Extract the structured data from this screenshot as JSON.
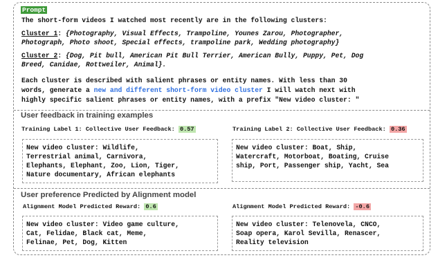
{
  "prompt": {
    "tag": "Prompt",
    "intro": "The short-form videos I watched most recently are in the following clusters:",
    "cluster1_label": "Cluster 1",
    "cluster1_line1": "{Photography, Visual Effects, Trampoline, Younes Zarou, Photographer,",
    "cluster1_line2": "Photograph, Photo shoot, Special effects, trampoline park, Wedding photography}",
    "cluster2_label": "Cluster 2",
    "cluster2_line1": "{Dog, Pit bull, American Pit Bull Terrier, American Bully, Puppy, Pet, Dog",
    "cluster2_line2": "Breed, Canidae, Rottweiler, Animal}.",
    "instr_line1": "Each cluster is described with salient phrases or entity names. With less than 30",
    "instr_line2_a": "words, generate a ",
    "instr_line2_highlight": "new and different short-form video cluster",
    "instr_line2_b": " I will watch next with",
    "instr_line3": "highly specific salient phrases or entity names, with a prefix \"New video cluster: \""
  },
  "feedback": {
    "heading": "User feedback in training examples",
    "left": {
      "label": "Training Label 1: Collective User Feedback:",
      "score": "0.57",
      "lines": [
        "New video cluster: Wildlife,",
        "Terrestrial animal, Carnivora,",
        "Elephants, Elephant, Zoo, Lion, Tiger,",
        "Nature documentary, African elephants"
      ]
    },
    "right": {
      "label": "Training Label 2: Collective User Feedback:",
      "score": "0.36",
      "lines": [
        "New video cluster: Boat, Ship,",
        "Watercraft, Motorboat, Boating, Cruise",
        "ship, Port, Passenger ship, Yacht, Sea"
      ]
    }
  },
  "alignment": {
    "heading": "User preference Predicted by Alignment model",
    "left": {
      "label": "Alignment Model Predicted Reward:",
      "score": "0.6",
      "lines": [
        "New video cluster: Video game culture,",
        "Cat, Felidae, Black cat, Meme,",
        "Felinae, Pet, Dog, Kitten"
      ]
    },
    "right": {
      "label": "Alignment Model Predicted Reward:",
      "score": "-0.6",
      "lines": [
        "New video cluster: Telenovela, CNCO,",
        "Soap opera, Karol Sevilla, Renascer,",
        "Reality television"
      ]
    }
  },
  "colors": {
    "green_tag": "#3f9a3a",
    "blue_text": "#2e6fe0",
    "green_hl": "#bfe6b0",
    "red_hl": "#f3a6a6"
  }
}
